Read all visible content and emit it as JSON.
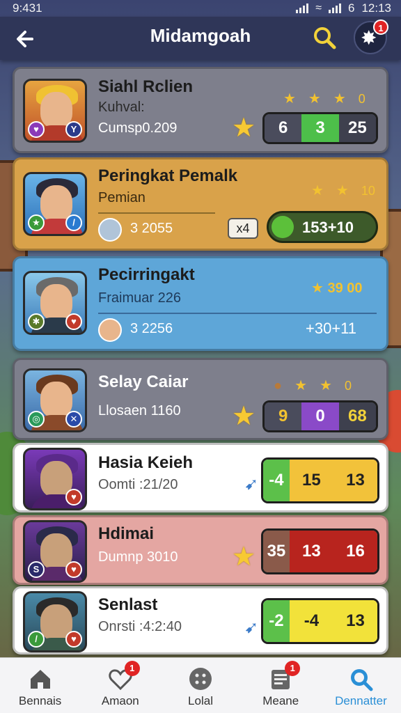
{
  "status_bar": {
    "time": "9:431",
    "carrier": "6",
    "clock": "12:13"
  },
  "header": {
    "title": "Midamgoah",
    "notification_count": "1"
  },
  "cards": [
    {
      "name": "Siahl Rclien",
      "sub": "Kuhval:",
      "score": "Cumsp0.209",
      "stars_num": "0",
      "bar": [
        "6",
        "3",
        "25"
      ]
    },
    {
      "name": "Peringkat Pemalk",
      "sub": "Pemian",
      "score": "3 2055",
      "multiplier": "x4",
      "pill": "153+10",
      "stars_num": "10"
    },
    {
      "name": "Pecirringakt",
      "sub": "Fraimuar 226",
      "score": "3 2256",
      "stars_text": "39  00",
      "pill": "+30+11"
    },
    {
      "name": "Selay Caiar",
      "sub": "Llosaen 1160",
      "stars_num": "0",
      "bar": [
        "9",
        "0",
        "68"
      ]
    },
    {
      "name": "Hasia Keieh",
      "sub": "Oomti :21/20",
      "bar": [
        "-4",
        "15",
        "13"
      ]
    },
    {
      "name": "Hdimai",
      "sub": "Dumnp 3010",
      "bar": [
        "35",
        "13",
        "16"
      ]
    },
    {
      "name": "Senlast",
      "sub": "Onrsti :4:2:40",
      "bar": [
        "-2",
        "-4",
        "13"
      ]
    }
  ],
  "bottom_nav": [
    {
      "label": "Bennais",
      "icon": "home-icon"
    },
    {
      "label": "Amaon",
      "icon": "heart-icon",
      "badge": "1"
    },
    {
      "label": "Lolal",
      "icon": "dots-icon"
    },
    {
      "label": "Meane",
      "icon": "list-icon",
      "badge": "1"
    },
    {
      "label": "Dennatter",
      "icon": "search-profile-icon",
      "active": true
    }
  ],
  "colors": {
    "header_bg": "#2f3658",
    "accent_blue": "#2a8fd6",
    "star_gold": "#f2c230",
    "badge_red": "#e02424"
  }
}
